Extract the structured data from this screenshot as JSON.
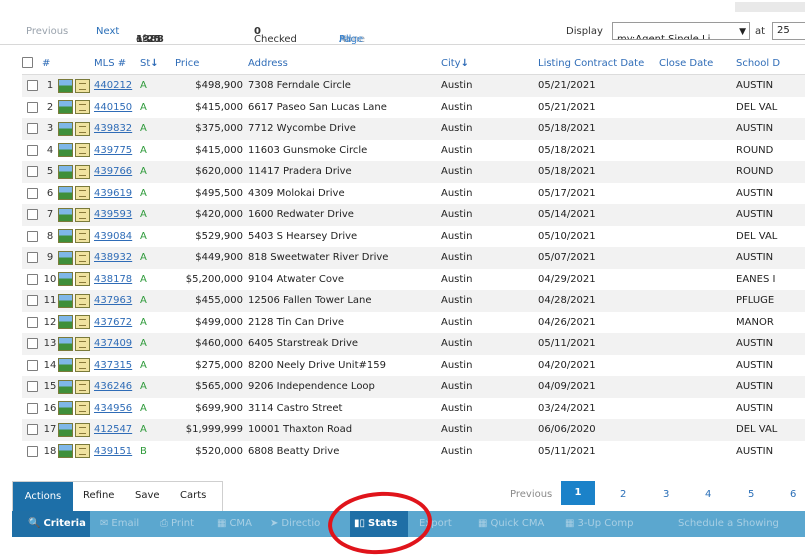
{
  "pager": {
    "previous": "Previous",
    "next": "Next",
    "range_prefix": "· ",
    "range": "1-25",
    "range_of": " of ",
    "total": "1388",
    "checked_label": "Checked ",
    "checked_count": "0",
    "select_all": "All",
    "select_none": "None",
    "select_page": "Page",
    "separator": " · ",
    "display_label": "Display",
    "display_value": "my:Agent Single Li",
    "at_label": "at",
    "per_page": "25"
  },
  "columns": {
    "mls": "MLS #",
    "status": "St",
    "price": "Price",
    "address": "Address",
    "city": "City",
    "listing_contract_date": "Listing Contract Date",
    "close_date": "Close Date",
    "school": "School D",
    "num": "#"
  },
  "rows": [
    {
      "num": "1",
      "mls": "440212",
      "st": "A",
      "price": "$498,900",
      "address": "7308 Ferndale Circle",
      "city": "Austin",
      "lcd": "05/21/2021",
      "close": "",
      "school": "AUSTIN"
    },
    {
      "num": "2",
      "mls": "440150",
      "st": "A",
      "price": "$415,000",
      "address": "6617 Paseo San Lucas Lane",
      "city": "Austin",
      "lcd": "05/21/2021",
      "close": "",
      "school": "DEL VAL"
    },
    {
      "num": "3",
      "mls": "439832",
      "st": "A",
      "price": "$375,000",
      "address": "7712 Wycombe Drive",
      "city": "Austin",
      "lcd": "05/18/2021",
      "close": "",
      "school": "AUSTIN"
    },
    {
      "num": "4",
      "mls": "439775",
      "st": "A",
      "price": "$415,000",
      "address": "11603 Gunsmoke Circle",
      "city": "Austin",
      "lcd": "05/18/2021",
      "close": "",
      "school": "ROUND"
    },
    {
      "num": "5",
      "mls": "439766",
      "st": "A",
      "price": "$620,000",
      "address": "11417 Pradera Drive",
      "city": "Austin",
      "lcd": "05/18/2021",
      "close": "",
      "school": "ROUND"
    },
    {
      "num": "6",
      "mls": "439619",
      "st": "A",
      "price": "$495,500",
      "address": "4309 Molokai Drive",
      "city": "Austin",
      "lcd": "05/17/2021",
      "close": "",
      "school": "AUSTIN"
    },
    {
      "num": "7",
      "mls": "439593",
      "st": "A",
      "price": "$420,000",
      "address": "1600 Redwater Drive",
      "city": "Austin",
      "lcd": "05/14/2021",
      "close": "",
      "school": "AUSTIN"
    },
    {
      "num": "8",
      "mls": "439084",
      "st": "A",
      "price": "$529,900",
      "address": "5403 S Hearsey Drive",
      "city": "Austin",
      "lcd": "05/10/2021",
      "close": "",
      "school": "DEL VAL"
    },
    {
      "num": "9",
      "mls": "438932",
      "st": "A",
      "price": "$449,900",
      "address": "818 Sweetwater River Drive",
      "city": "Austin",
      "lcd": "05/07/2021",
      "close": "",
      "school": "AUSTIN"
    },
    {
      "num": "10",
      "mls": "438178",
      "st": "A",
      "price": "$5,200,000",
      "address": "9104 Atwater Cove",
      "city": "Austin",
      "lcd": "04/29/2021",
      "close": "",
      "school": "EANES I"
    },
    {
      "num": "11",
      "mls": "437963",
      "st": "A",
      "price": "$455,000",
      "address": "12506 Fallen Tower Lane",
      "city": "Austin",
      "lcd": "04/28/2021",
      "close": "",
      "school": "PFLUGE"
    },
    {
      "num": "12",
      "mls": "437672",
      "st": "A",
      "price": "$499,000",
      "address": "2128 Tin Can Drive",
      "city": "Austin",
      "lcd": "04/26/2021",
      "close": "",
      "school": "MANOR"
    },
    {
      "num": "13",
      "mls": "437409",
      "st": "A",
      "price": "$460,000",
      "address": "6405 Starstreak Drive",
      "city": "Austin",
      "lcd": "05/11/2021",
      "close": "",
      "school": "AUSTIN"
    },
    {
      "num": "14",
      "mls": "437315",
      "st": "A",
      "price": "$275,000",
      "address": "8200 Neely Drive Unit#159",
      "city": "Austin",
      "lcd": "04/20/2021",
      "close": "",
      "school": "AUSTIN"
    },
    {
      "num": "15",
      "mls": "436246",
      "st": "A",
      "price": "$565,000",
      "address": "9206 Independence Loop",
      "city": "Austin",
      "lcd": "04/09/2021",
      "close": "",
      "school": "AUSTIN"
    },
    {
      "num": "16",
      "mls": "434956",
      "st": "A",
      "price": "$699,900",
      "address": "3114 Castro Street",
      "city": "Austin",
      "lcd": "03/24/2021",
      "close": "",
      "school": "AUSTIN"
    },
    {
      "num": "17",
      "mls": "412547",
      "st": "A",
      "price": "$1,999,999",
      "address": "10001 Thaxton Road",
      "city": "Austin",
      "lcd": "06/06/2020",
      "close": "",
      "school": "DEL VAL"
    },
    {
      "num": "18",
      "mls": "439151",
      "st": "B",
      "price": "$520,000",
      "address": "6808 Beatty Drive",
      "city": "Austin",
      "lcd": "05/11/2021",
      "close": "",
      "school": "AUSTIN"
    }
  ],
  "tabs": [
    "Actions",
    "Refine",
    "Save",
    "Carts"
  ],
  "pagination": {
    "previous": "Previous",
    "pages": [
      "1",
      "2",
      "3",
      "4",
      "5",
      "6"
    ]
  },
  "actions": {
    "criteria": "Criteria",
    "email": "Email",
    "print": "Print",
    "cma": "CMA",
    "directions": "Directio",
    "stats": "Stats",
    "export": "Export",
    "quick_cma": "Quick CMA",
    "three_up": "3-Up Comp",
    "schedule": "Schedule a Showing"
  },
  "colors": {
    "accent": "#1f6fa6",
    "toolbar": "#5ba7cf",
    "highlight_circle": "#e0141b",
    "link": "#2f6cb7",
    "status": "#2e9a3a"
  }
}
